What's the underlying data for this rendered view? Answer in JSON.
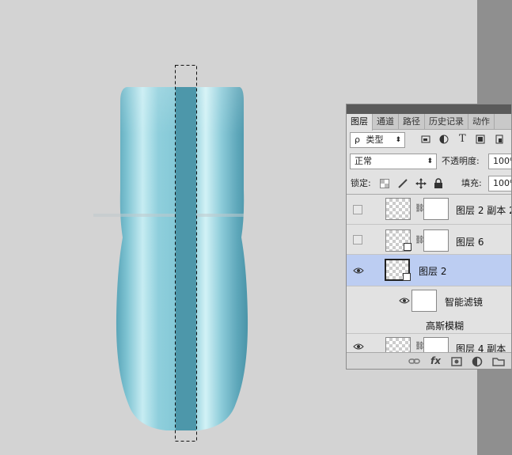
{
  "panel": {
    "tabs": [
      {
        "label": "图层",
        "active": true
      },
      {
        "label": "通道",
        "active": false
      },
      {
        "label": "路径",
        "active": false
      },
      {
        "label": "历史记录",
        "active": false
      },
      {
        "label": "动作",
        "active": false
      }
    ],
    "filter": {
      "search_glyph": "ρ",
      "label": "类型",
      "arrow": "⬍"
    },
    "filter_icons": [
      "image-filter-icon",
      "adjustment-filter-icon",
      "T",
      "shape-filter-icon"
    ],
    "blend_mode": "正常",
    "opacity_label": "不透明度:",
    "opacity_value": "100%",
    "lock_label": "锁定:",
    "fill_label": "填充:",
    "fill_value": "100%",
    "layers": [
      {
        "name": "图层 2 副本 2",
        "visible": false,
        "selected": false
      },
      {
        "name": "图层 6",
        "visible": false,
        "selected": false
      },
      {
        "name": "图层 2",
        "visible": true,
        "selected": true
      },
      {
        "name": "智能滤镜",
        "visible": true,
        "selected": false,
        "sub": true
      },
      {
        "name": "高斯模糊",
        "visible": false,
        "selected": false,
        "filter": true
      },
      {
        "name": "图层 4 副本",
        "visible": true,
        "selected": false
      }
    ],
    "bottom_icons": [
      "link-icon",
      "fx",
      "mask-icon",
      "adjustment-icon",
      "folder-icon"
    ],
    "fx_label": "fx"
  },
  "colors": {
    "canvas_bg": "#d3d3d3",
    "selected_row": "#bccdf2",
    "vase_dark": "#4f9aae",
    "vase_light": "#c6ecf2",
    "stripe": "#4d97aa"
  }
}
